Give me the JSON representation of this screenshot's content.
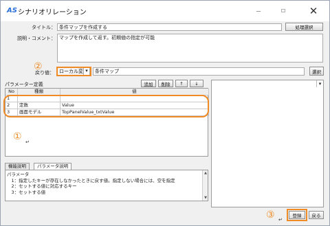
{
  "window": {
    "icon": "AS",
    "title": "シナリオリレーション",
    "minimize": "—",
    "maximize": "☐",
    "close": "✕"
  },
  "form": {
    "title_label": "タイトル：",
    "title_value": "条件マップを作成する",
    "process_select_button": "処理選択",
    "desc_label": "説明・コメント：",
    "desc_value": "マップを作成して返す。初期値の指定が可能",
    "return_label": "戻り値：",
    "return_select": "ローカル変数",
    "return_value": "条件マップ",
    "return_select_button": "選択"
  },
  "params": {
    "title": "パラメーター定義",
    "add_button": "追加",
    "delete_button": "削除",
    "up_button": "↑",
    "down_button": "↓",
    "columns": [
      "No",
      "種類",
      "値"
    ],
    "rows": [
      {
        "no": "1",
        "type": "",
        "value": ""
      },
      {
        "no": "2",
        "type": "定数",
        "value": "Value"
      },
      {
        "no": "3",
        "type": "画面モデル",
        "value": "TopPanelValue_txtValue"
      }
    ]
  },
  "annotations": {
    "marker1": "①",
    "marker2": "②",
    "marker3": "③"
  },
  "tabs": [
    {
      "label": "機能説明"
    },
    {
      "label": "パラメータ説明"
    }
  ],
  "help_lines": [
    "パラメータ",
    "　1：指定したキーが存在しなかったときに戻す値。指定しない場合には、空を指定",
    "　2：セットする値に対応するキー",
    "　3：セットする値"
  ],
  "footer": {
    "ok_button": "登録",
    "back_button": "戻る"
  },
  "colors": {
    "highlight": "#f08a24",
    "icon": "#2a6fd6"
  }
}
